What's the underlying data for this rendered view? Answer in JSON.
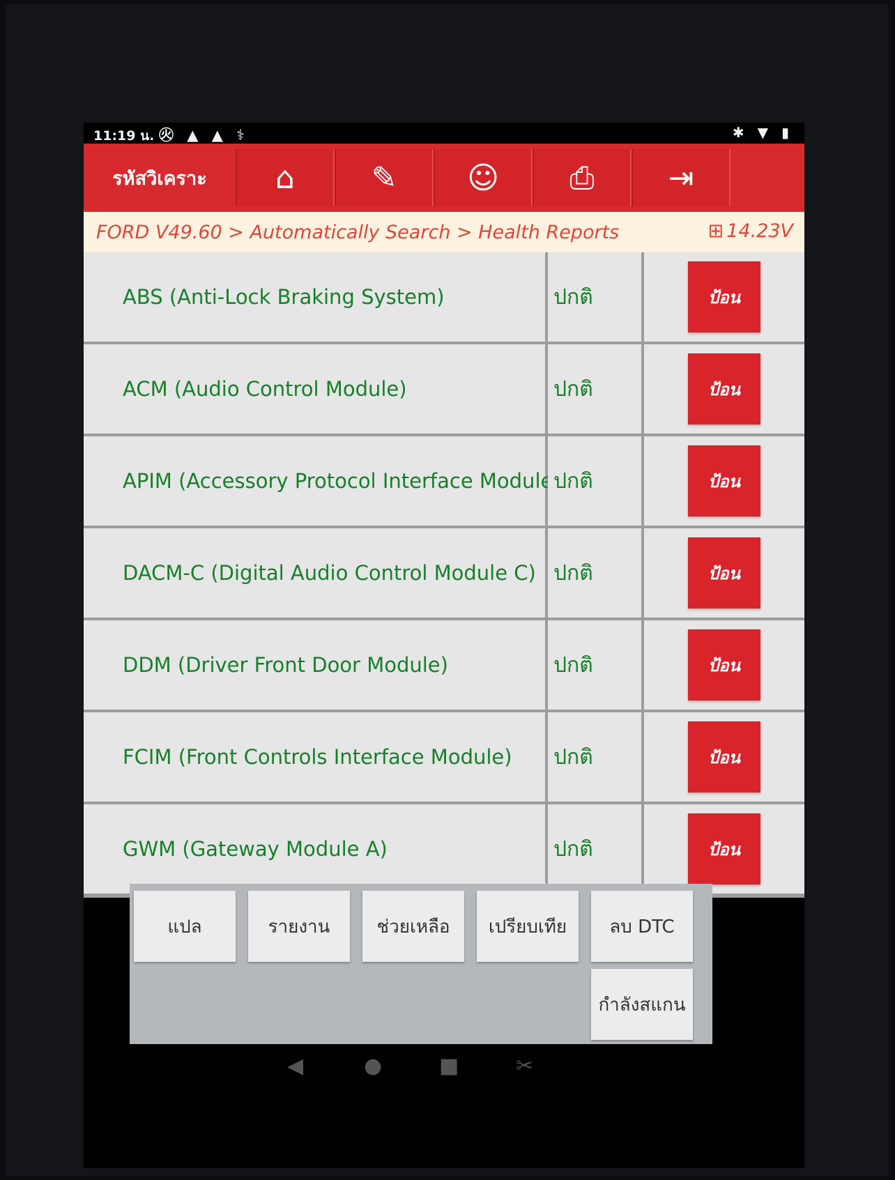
{
  "status_bar": {
    "time": "11:19 น.",
    "left_icons": "㊋ ▲ ▲ ⚕",
    "right_icons": "✱ ▼ ▮"
  },
  "header": {
    "title": "รหัสวิเคราะ",
    "buttons": [
      {
        "icon": "home-icon",
        "glyph": "⌂"
      },
      {
        "icon": "edit-icon",
        "glyph": "✎"
      },
      {
        "icon": "support-icon",
        "glyph": "☺"
      },
      {
        "icon": "print-icon",
        "glyph": "⎙"
      },
      {
        "icon": "exit-icon",
        "glyph": "⇥"
      }
    ]
  },
  "breadcrumb": {
    "path": "FORD V49.60 > Automatically Search > Health Reports",
    "battery_icon": "⊞",
    "voltage": "14.23V"
  },
  "modules": [
    {
      "name": "ABS (Anti-Lock Braking System)",
      "status": "ปกติ",
      "action": "ป้อน"
    },
    {
      "name": "ACM (Audio Control Module)",
      "status": "ปกติ",
      "action": "ป้อน"
    },
    {
      "name": "APIM (Accessory Protocol Interface Module)",
      "status": "ปกติ",
      "action": "ป้อน"
    },
    {
      "name": "DACM-C (Digital Audio Control Module C)",
      "status": "ปกติ",
      "action": "ป้อน"
    },
    {
      "name": "DDM (Driver Front Door Module)",
      "status": "ปกติ",
      "action": "ป้อน"
    },
    {
      "name": "FCIM (Front Controls Interface Module)",
      "status": "ปกติ",
      "action": "ป้อน"
    },
    {
      "name": "GWM (Gateway Module A)",
      "status": "ปกติ",
      "action": "ป้อน"
    }
  ],
  "footer_buttons": {
    "translate": "แปล",
    "report": "รายงาน",
    "help": "ช่วยเหลือ",
    "compare": "เปรียบเทีย",
    "clear_dtc": "ลบ DTC",
    "scanning": "กำลังสแกน"
  },
  "nav_bar": {
    "back": "◀",
    "home": "●",
    "recents": "■",
    "screenshot": "✂"
  }
}
